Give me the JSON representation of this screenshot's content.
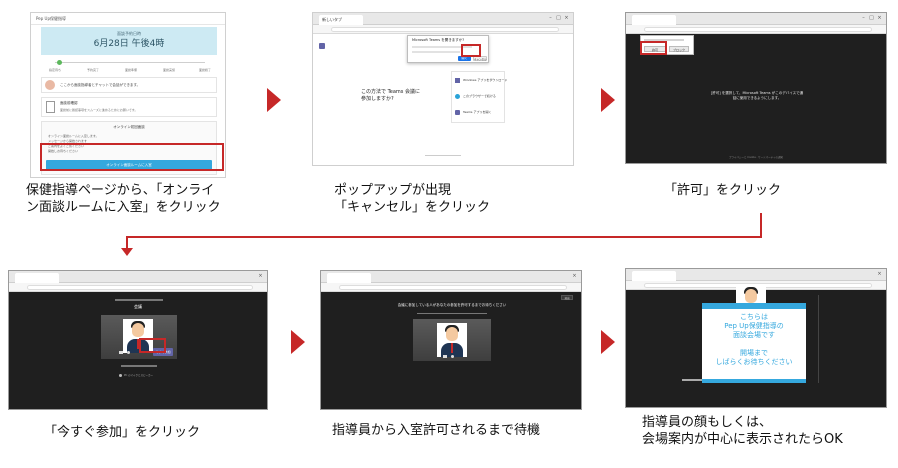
{
  "colors": {
    "accent": "#c62828",
    "info_blue": "#35a8de",
    "teams_purple": "#6264a7",
    "dark_bg": "#1f1f1f"
  },
  "steps": [
    {
      "caption": "保健指導ページから、「オンライ\nン面談ルームに入室」をクリック",
      "screen": {
        "app_title": "Pep Up保健指導",
        "schedule_label": "面談予約日時",
        "schedule_datetime": "6月28日 午後4時",
        "step_labels": [
          "指定待ち",
          "予約完了",
          "面談準備",
          "面談実施",
          "面談終了"
        ],
        "message_text": "ここから面談指導者とチャットで会話ができます。",
        "prep_title": "面談前確認",
        "prep_text": "面談前に確認事項をスムーズに進めるためにお願いです。",
        "online_title": "オンライン初回面談",
        "online_lines": [
          "オンライン面談ルームに入室します。",
          "メッセージから開始されます",
          "ご案内をよくご覧ください",
          "開始しお待ちください"
        ],
        "enter_button": "オンライン面談ルームに入室"
      }
    },
    {
      "caption": "ポップアップが出現\n「キャンセル」をクリック",
      "screen": {
        "tab_title": "新しいタブ",
        "dialog_title": "Microsoft Teams を開きますか?",
        "dialog_button_open": "開く",
        "dialog_button_cancel": "キャンセル",
        "join_heading": "この方法で Teams 会議に参加しますか?",
        "options": [
          "Windows アプリをダウンロード",
          "このブラウザーで続ける",
          "Teams アプリを開く"
        ]
      }
    },
    {
      "caption": "「許可」をクリック",
      "screen": {
        "prompt_allow": "許可",
        "prompt_block": "ブロック",
        "message": "[許可] を選択して、Microsoft Teams がこのデバイスで通話に使用できるようにします。",
        "footer": "プライバシーと Cookie · サードパーティの通知"
      }
    },
    {
      "caption": "「今すぐ参加」をクリック",
      "screen": {
        "meeting_label": "会議",
        "join_button": "今すぐ参加",
        "audio_option": "PC のマイクとスピーカー"
      }
    },
    {
      "caption": "指導員から入室許可されるまで待機",
      "screen": {
        "waiting_message": "会議に参加している人があなたの参加を許可するまでお待ちください",
        "leave_button": "退出"
      }
    },
    {
      "caption": "指導員の顔もしくは、\n会場案内が中心に表示されたらOK",
      "screen": {
        "notice_lines": [
          "こちらは",
          "Pep Up保健指導の",
          "面談会場です"
        ],
        "notice_lines2": [
          "開場まで",
          "しばらくお待ちください"
        ]
      }
    }
  ]
}
